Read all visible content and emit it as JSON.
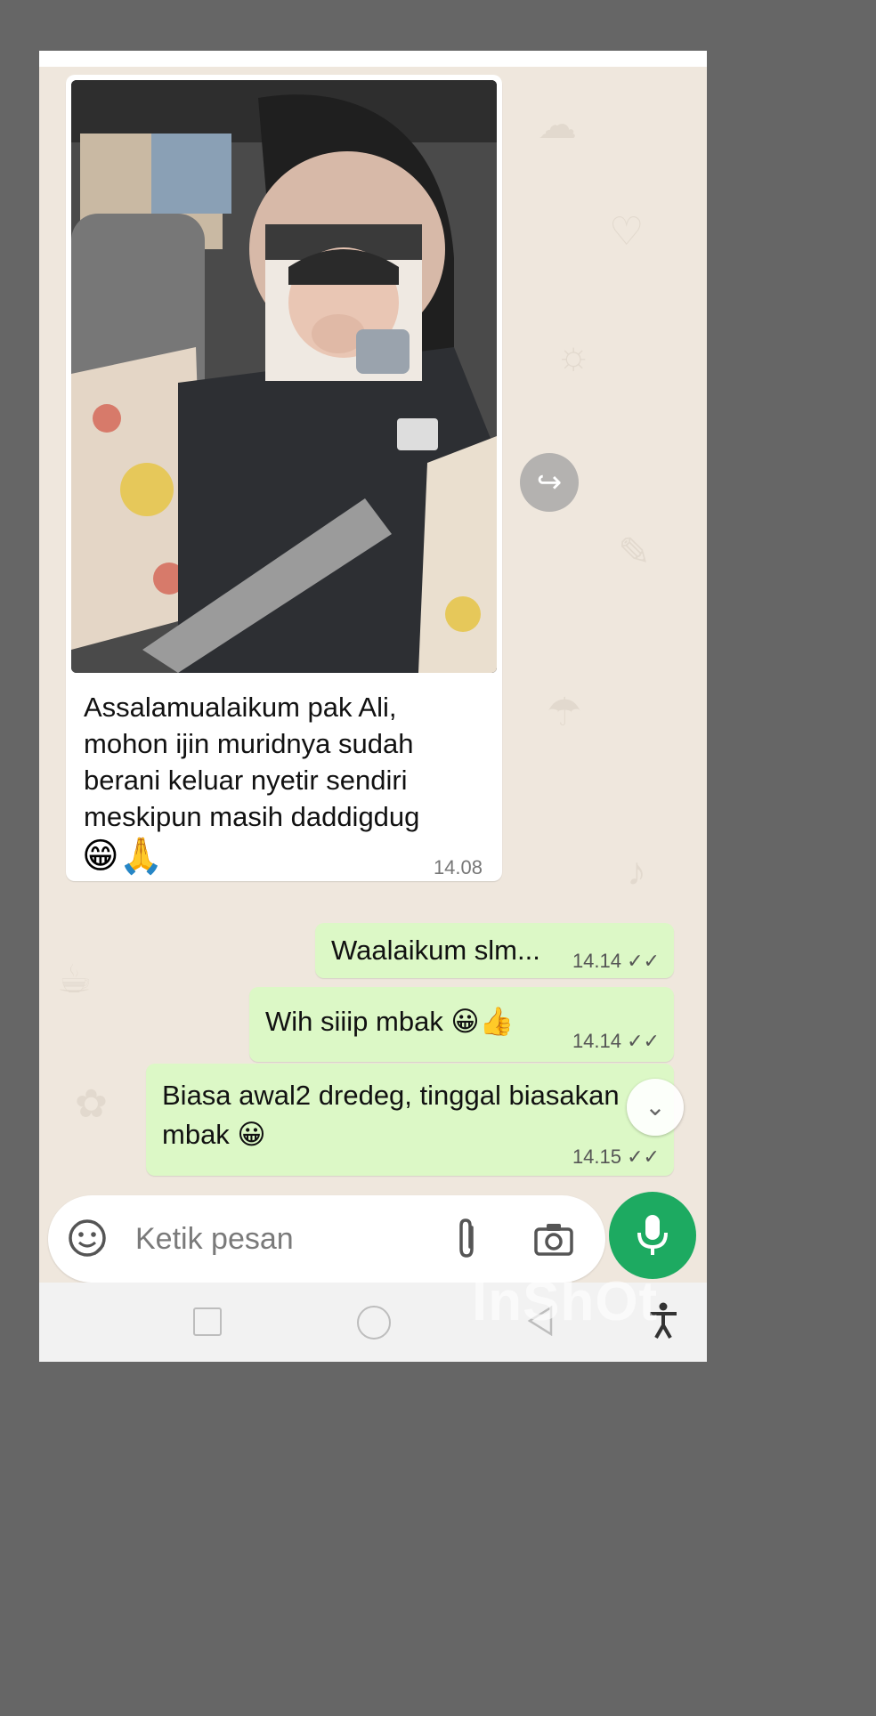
{
  "chat": {
    "incoming": {
      "text_lines": [
        "Assalamualaikum pak Ali,",
        "mohon ijin muridnya sudah",
        "berani keluar nyetir sendiri",
        "meskipun masih daddigdug"
      ],
      "emoji": "😁🙏",
      "time": "14.08"
    },
    "outgoing": [
      {
        "text": "Waalaikum slm...",
        "time": "14.14",
        "status": "read"
      },
      {
        "text": "Wih siiip mbak 😀👍",
        "time": "14.14",
        "status": "read"
      },
      {
        "text_lines": [
          "Biasa awal2 dredeg, tinggal biasakan",
          "mbak 😀"
        ],
        "time": "14.15",
        "status": "read"
      }
    ],
    "ticks_glyph": "✓✓"
  },
  "icons": {
    "forward": "forward-icon",
    "scroll_down": "double-chevron-down-icon",
    "sticker": "sticker-icon",
    "attach": "paperclip-icon",
    "camera": "camera-icon",
    "mic": "microphone-icon",
    "nav_recent": "square-icon",
    "nav_home": "circle-icon",
    "nav_back": "triangle-back-icon",
    "accessibility": "accessibility-icon"
  },
  "composer": {
    "placeholder": "Ketik pesan"
  },
  "watermark": "InShOt",
  "colors": {
    "outgoing_bubble": "#dcf8c6",
    "incoming_bubble": "#ffffff",
    "accent": "#1daa61",
    "wallpaper": "#efe7dd"
  }
}
